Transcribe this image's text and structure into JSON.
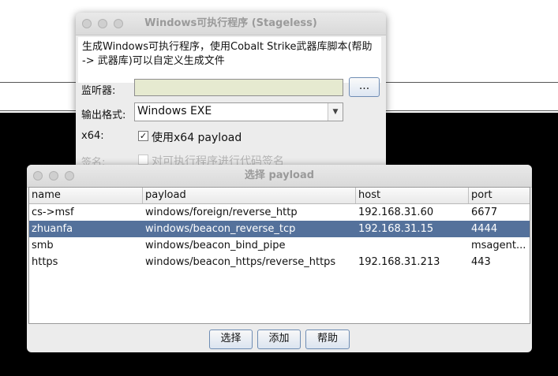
{
  "stageless_dialog": {
    "title": "Windows可执行程序 (Stageless)",
    "description": "生成Windows可执行程序，使用Cobalt Strike武器库脚本(帮助 -> 武器库)可以自定义生成文件",
    "listener_label": "监听器:",
    "listener_value": "",
    "browse_label": "...",
    "format_label": "输出格式:",
    "format_value": "Windows EXE",
    "x64_label": "x64:",
    "x64_checkbox_label": "使用x64 payload",
    "x64_checked": true,
    "sign_label": "签名:",
    "sign_checkbox_label": "对可执行程序进行代码签名",
    "sign_checked": false
  },
  "payload_dialog": {
    "title": "选择 payload",
    "columns": [
      "name",
      "payload",
      "host",
      "port"
    ],
    "rows": [
      {
        "name": "cs->msf",
        "payload": "windows/foreign/reverse_http",
        "host": "192.168.31.60",
        "port": "6677"
      },
      {
        "name": "zhuanfa",
        "payload": "windows/beacon_reverse_tcp",
        "host": "192.168.31.15",
        "port": "4444"
      },
      {
        "name": "smb",
        "payload": "windows/beacon_bind_pipe",
        "host": "",
        "port": "msagent..."
      },
      {
        "name": "https",
        "payload": "windows/beacon_https/reverse_https",
        "host": "192.168.31.213",
        "port": "443"
      }
    ],
    "selected_row": 1,
    "buttons": {
      "choose": "选择",
      "add": "添加",
      "help": "帮助"
    }
  }
}
